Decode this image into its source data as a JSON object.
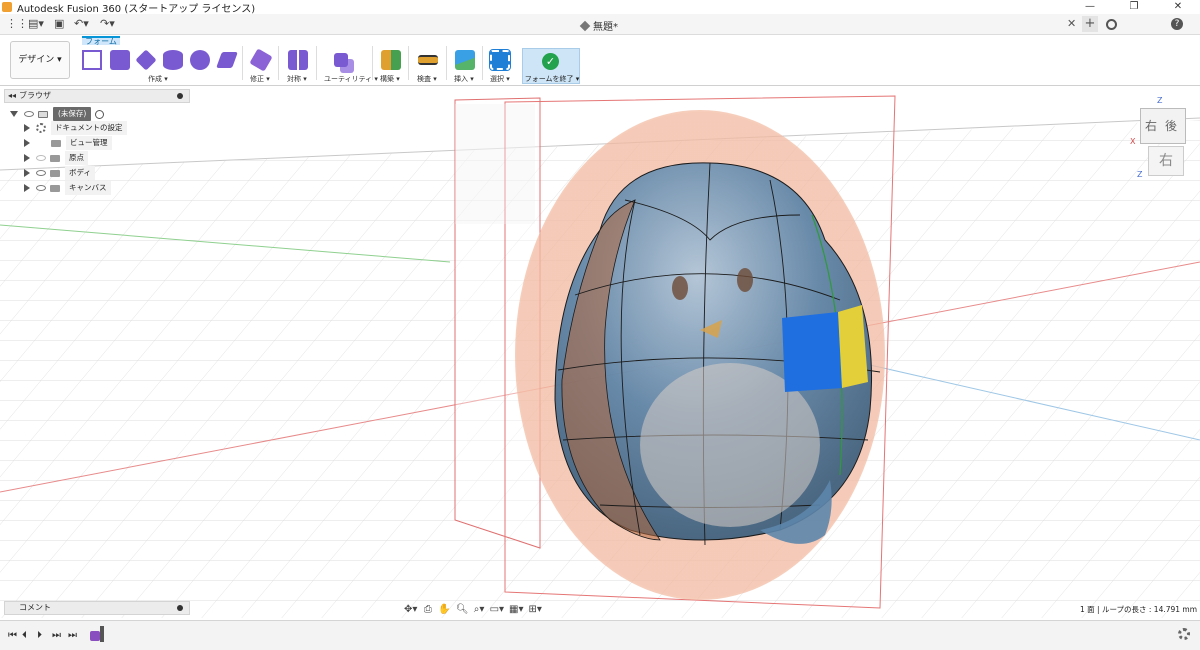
{
  "window": {
    "title": "Autodesk Fusion 360 (スタートアップ ライセンス)",
    "controls": [
      "—",
      "❐",
      "✕"
    ]
  },
  "appbar": {
    "document_title": "無題*"
  },
  "ribbon": {
    "workspace": "デザイン ▾",
    "active_tab": "フォーム",
    "groups": {
      "create": "作成 ▾",
      "modify": "修正 ▾",
      "symmetry": "対称 ▾",
      "utility": "ユーティリティ ▾",
      "construct": "構築 ▾",
      "inspect": "検査 ▾",
      "insert": "挿入 ▾",
      "select": "選択 ▾",
      "finish": "フォームを終了 ▾"
    },
    "colors": {
      "form_tools": "#7a5ad1",
      "accent": "#0696d7",
      "finish_check": "#23a24d"
    }
  },
  "browser": {
    "title": "ブラウザ",
    "root": "(未保存)",
    "items": [
      {
        "label": "ドキュメントの設定",
        "icon": "gear-icon"
      },
      {
        "label": "ビュー管理",
        "icon": "folder-icon"
      },
      {
        "label": "原点",
        "icon": "folder-icon"
      },
      {
        "label": "ボディ",
        "icon": "folder-icon"
      },
      {
        "label": "キャンバス",
        "icon": "folder-icon"
      }
    ]
  },
  "comment": {
    "label": "コメント"
  },
  "viewcube": {
    "face_right": "右",
    "face_back": "後",
    "face_front": "右"
  },
  "status": {
    "text": "1 面 | ループの長さ : 14.791 mm"
  },
  "timeline": {
    "controls": [
      "⏮",
      "⏴",
      "⏵",
      "⏭",
      "⏭"
    ]
  }
}
